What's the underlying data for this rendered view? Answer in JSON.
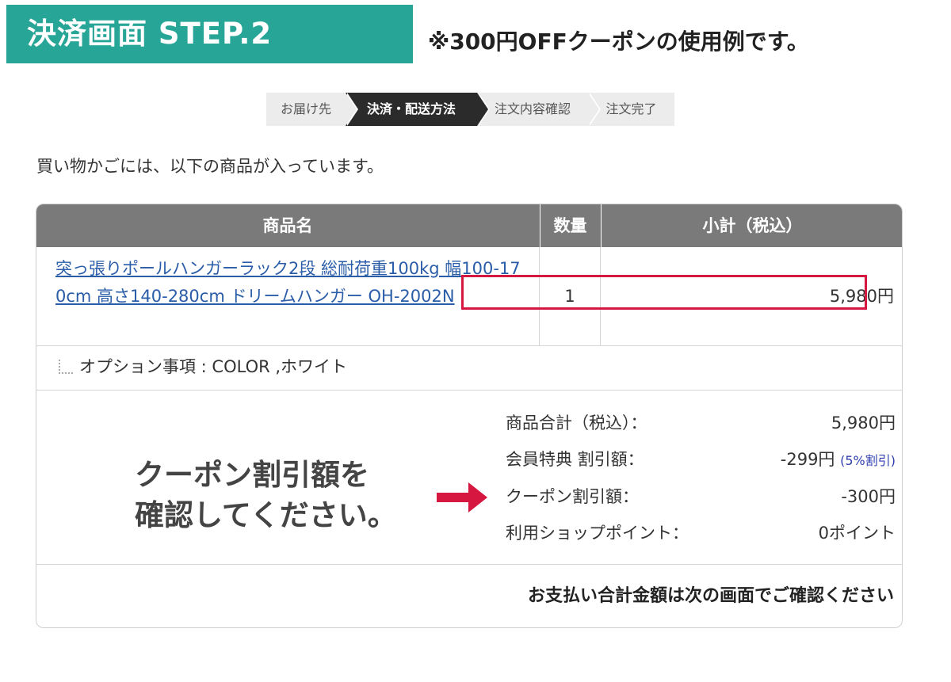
{
  "banner": {
    "title": "決済画面 STEP.2"
  },
  "note": "※300円OFFクーポンの使用例です。",
  "progress": {
    "steps": [
      {
        "label": "お届け先",
        "active": false
      },
      {
        "label": "決済・配送方法",
        "active": true
      },
      {
        "label": "注文内容確認",
        "active": false
      },
      {
        "label": "注文完了",
        "active": false
      }
    ]
  },
  "cart": {
    "intro": "買い物かごには、以下の商品が入っています。",
    "headers": {
      "name": "商品名",
      "qty": "数量",
      "subtotal": "小計（税込）"
    },
    "item": {
      "name": "突っ張りポールハンガーラック2段 総耐荷重100kg 幅100-170cm 高さ140-280cm ドリームハンガー OH-2002N",
      "qty": "1",
      "subtotal": "5,980円"
    },
    "option": "オプション事項 : COLOR ,ホワイト",
    "totals": {
      "goods_label": "商品合計（税込）：",
      "goods_value": "5,980円",
      "member_label": "会員特典 割引額：",
      "member_value": "-299円",
      "member_rate": "(5%割引)",
      "coupon_label": "クーポン割引額：",
      "coupon_value": "-300円",
      "points_label": "利用ショップポイント：",
      "points_value": "0ポイント"
    },
    "final_note": "お支払い合計金額は次の画面でご確認ください"
  },
  "callout": {
    "line1": "クーポン割引額を",
    "line2": "確認してください。"
  },
  "colors": {
    "banner": "#27a597",
    "highlight": "#d6173f",
    "header": "#7a7a7a",
    "link": "#2a5da8"
  }
}
